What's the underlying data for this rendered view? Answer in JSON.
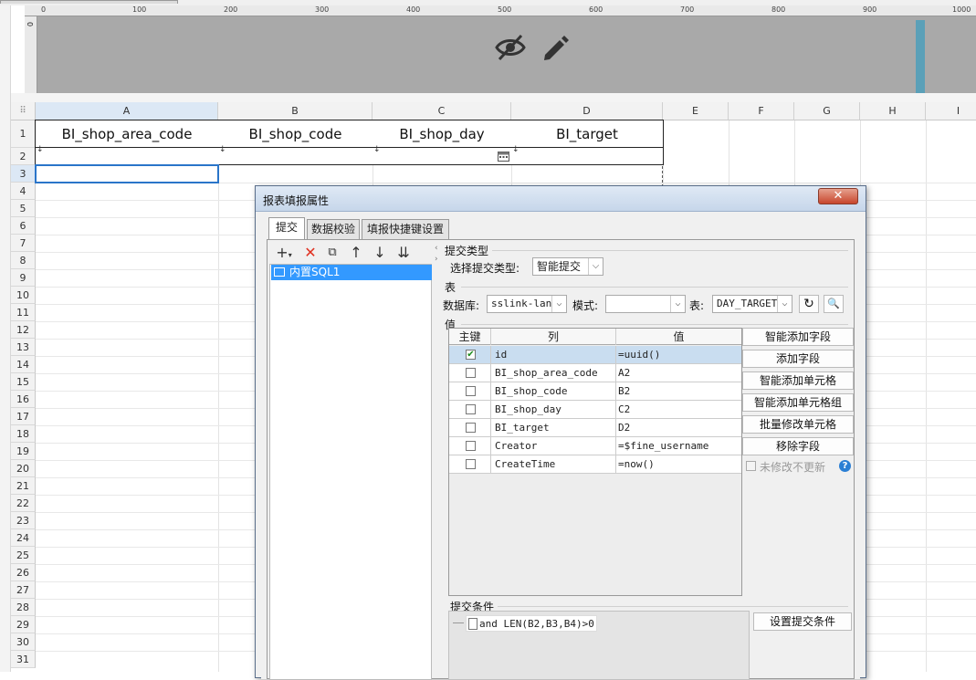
{
  "ruler": {
    "labels": [
      "0",
      "100",
      "200",
      "300",
      "400",
      "500",
      "600",
      "700",
      "800",
      "900",
      "1000"
    ]
  },
  "vruler": {
    "label": "0"
  },
  "header_icons": {
    "hidden": "eye-slash-icon",
    "edit": "pencil-icon"
  },
  "grid": {
    "columns": [
      "A",
      "B",
      "C",
      "D",
      "E",
      "F",
      "G",
      "H",
      "I"
    ],
    "rows": [
      "1",
      "2",
      "3",
      "4",
      "5",
      "6",
      "7",
      "8",
      "9",
      "10",
      "11",
      "12",
      "13",
      "14",
      "15",
      "16",
      "17",
      "18",
      "19",
      "20",
      "21",
      "22",
      "23",
      "24",
      "25",
      "26",
      "27",
      "28",
      "29",
      "30",
      "31"
    ],
    "header_cells": [
      "BI_shop_area_code",
      "BI_shop_code",
      "BI_shop_day",
      "BI_target"
    ],
    "row2_marker": "↓"
  },
  "dialog": {
    "title": "报表填报属性",
    "close": "✕",
    "tabs": [
      "提交",
      "数据校验",
      "填报快捷键设置"
    ],
    "sql_item": "内置SQL1",
    "submit_type_section": "提交类型",
    "submit_type_label": "选择提交类型:",
    "submit_type_value": "智能提交",
    "table_section": "表",
    "db_label": "数据库:",
    "db_value": "sslink-lan",
    "schema_label": "模式:",
    "schema_value": "",
    "table_label": "表:",
    "table_value": "DAY_TARGET",
    "value_section": "值",
    "field_headers": [
      "主键",
      "列",
      "值"
    ],
    "fields": [
      {
        "pk": true,
        "col": "id",
        "val": "=uuid()"
      },
      {
        "pk": false,
        "col": "BI_shop_area_code",
        "val": "A2"
      },
      {
        "pk": false,
        "col": "BI_shop_code",
        "val": "B2"
      },
      {
        "pk": false,
        "col": "BI_shop_day",
        "val": "C2"
      },
      {
        "pk": false,
        "col": "BI_target",
        "val": "D2"
      },
      {
        "pk": false,
        "col": "Creator",
        "val": "=$fine_username"
      },
      {
        "pk": false,
        "col": "CreateTime",
        "val": "=now()"
      }
    ],
    "side_buttons": [
      "智能添加字段",
      "添加字段",
      "智能添加单元格",
      "智能添加单元格组",
      "批量修改单元格",
      "移除字段"
    ],
    "no_update_label": "未修改不更新",
    "cond_section": "提交条件",
    "cond_value": "and LEN(B2,B3,B4)>0",
    "cond_button": "设置提交条件"
  }
}
